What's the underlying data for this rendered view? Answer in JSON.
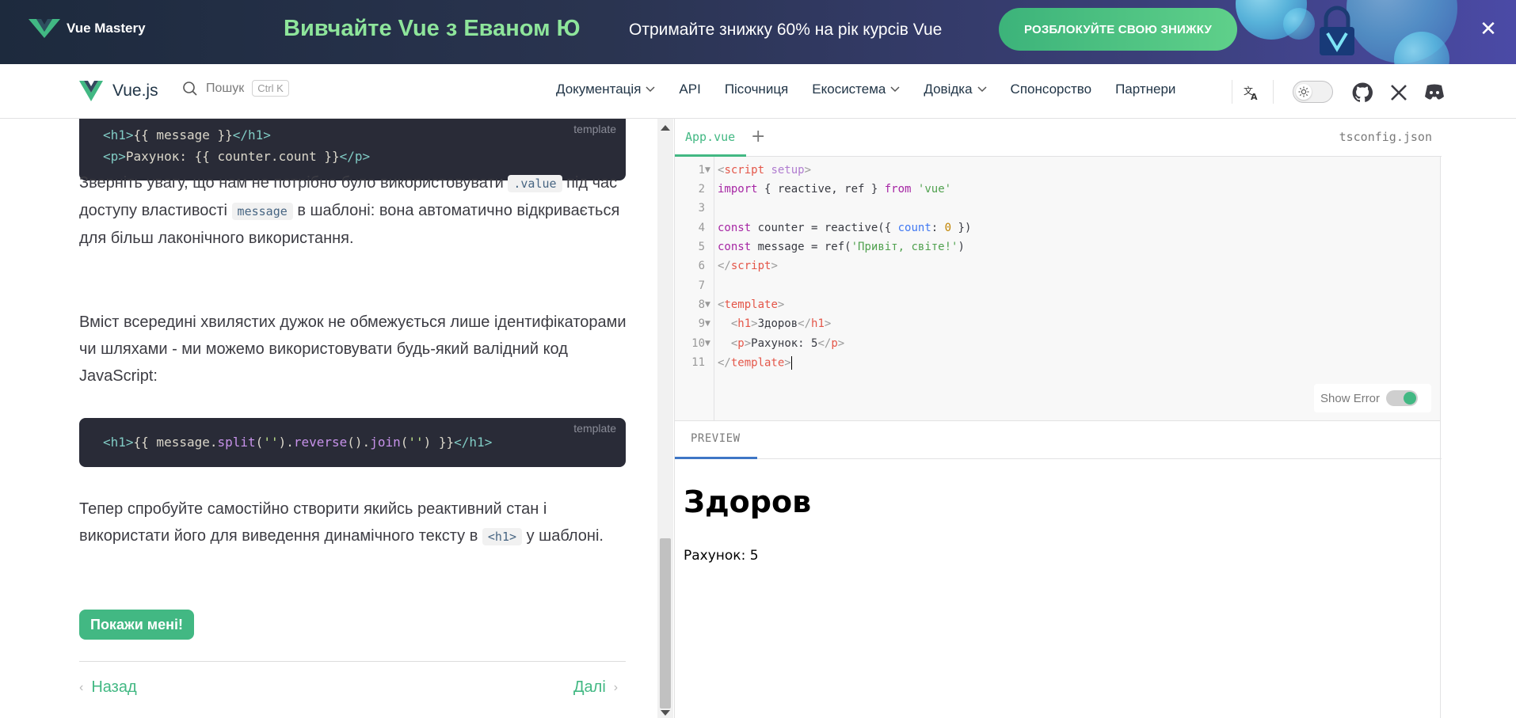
{
  "banner": {
    "logo_text": "Vue Mastery",
    "headline": "Вивчайте Vue з Еваном Ю",
    "sub": "Отримайте знижку 60% на рік курсів Vue",
    "cta": "РОЗБЛОКУЙТЕ СВОЮ ЗНИЖКУ",
    "close": "✕",
    "colors": {
      "accent": "#8ee59b",
      "cta": "#42b883"
    }
  },
  "nav": {
    "brand": "Vue.js",
    "search_label": "Пошук",
    "search_kbd": "Ctrl K",
    "items": [
      {
        "label": "Документація",
        "dropdown": true
      },
      {
        "label": "API",
        "dropdown": false
      },
      {
        "label": "Пісочниця",
        "dropdown": false
      },
      {
        "label": "Екосистема",
        "dropdown": true
      },
      {
        "label": "Довідка",
        "dropdown": true
      },
      {
        "label": "Спонсорство",
        "dropdown": false
      },
      {
        "label": "Партнери",
        "dropdown": false
      }
    ],
    "icons": [
      "translate-icon",
      "theme-switch",
      "github-icon",
      "x-icon",
      "discord-icon"
    ]
  },
  "content": {
    "code1": {
      "lang": "template",
      "line1_open": "<h1>",
      "line1_expr": "{{ message }}",
      "line1_close": "</h1>",
      "line2_open": "<p>",
      "line2_expr": "Рахунок: {{ counter.count }}",
      "line2_close": "</p>"
    },
    "p1_a": "Зверніть увагу, що нам не потрібно було використовувати",
    "p1_code1": ".value",
    "p1_b": "під час доступу властивості",
    "p1_code2": "message",
    "p1_c": "в шаблоні: вона автоматично відкривається для більш лаконічного використання.",
    "p2": "Вміст всередині хвилястих дужок не обмежується лише ідентифікаторами чи шляхами - ми можемо використовувати будь-який валідний код JavaScript:",
    "code2": {
      "lang": "template",
      "open": "<h1>",
      "t1": "{{ message.",
      "split": "split",
      "t2": "(",
      "q1": "''",
      "t3": ").",
      "reverse": "reverse",
      "t4": "().",
      "join": "join",
      "t5": "(",
      "q2": "''",
      "t6": ") }}",
      "close": "</h1>"
    },
    "p3_a": "Тепер спробуйте самостійно створити якийсь реактивний стан і використати його для виведення динамічного тексту в",
    "p3_code": "<h1>",
    "p3_b": "у шаблоні.",
    "show_button": "Покажи мені!",
    "prev": "Назад",
    "next": "Далі"
  },
  "editor": {
    "tab_active": "App.vue",
    "tab_add": "+",
    "tab_right": "tsconfig.json",
    "line_numbers": [
      "1",
      "2",
      "3",
      "4",
      "5",
      "6",
      "7",
      "8",
      "9",
      "10",
      "11"
    ],
    "lines": {
      "l1_kw": "script",
      "l1_attr": "setup",
      "l2_import": "import",
      "l2_mid": "{ reactive, ref }",
      "l2_from": "from",
      "l2_str": "'vue'",
      "l4_const": "const",
      "l4_mid": "counter = reactive({",
      "l4_prop": "count",
      "l4_colon": ":",
      "l4_num": "0",
      "l4_end": "})",
      "l5_const": "const",
      "l5_mid": "message = ref(",
      "l5_str": "'Привіт, світе!'",
      "l5_end": ")",
      "l6_tag": "script",
      "l8_tag": "template",
      "l9_tag": "h1",
      "l9_text": "Здоров",
      "l10_tag": "p",
      "l10_text": "Рахунок: 5",
      "l11_tag": "template"
    },
    "show_error": "Show Error"
  },
  "preview": {
    "tab": "PREVIEW",
    "h1": "Здоров",
    "p": "Рахунок: 5"
  }
}
